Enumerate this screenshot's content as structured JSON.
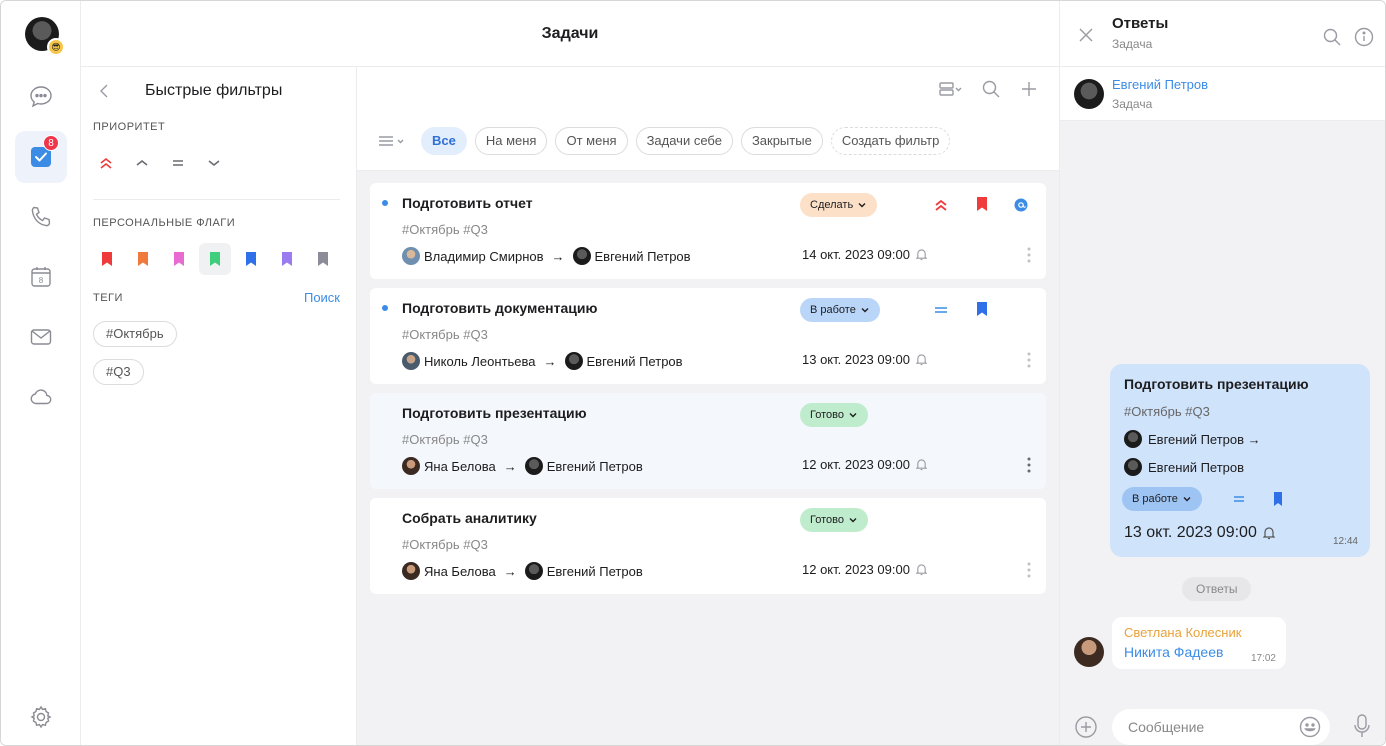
{
  "header": {
    "title": "Задачи"
  },
  "rail": {
    "tasks_badge": "8",
    "calendar_day": "8",
    "items": [
      "chat-icon",
      "tasks-icon",
      "phone-icon",
      "calendar-icon",
      "mail-icon",
      "cloud-icon",
      "settings-icon"
    ]
  },
  "filters": {
    "title": "Быстрые фильтры",
    "priority_label": "ПРИОРИТЕТ",
    "flags_label": "ПЕРСОНАЛЬНЫЕ ФЛАГИ",
    "flags": [
      {
        "color": "#ef3b3b"
      },
      {
        "color": "#f07a3c"
      },
      {
        "color": "#e86bd2"
      },
      {
        "color": "#3fce7c",
        "selected": true
      },
      {
        "color": "#2f6fe8"
      },
      {
        "color": "#9b7cf0"
      },
      {
        "color": "#8c8c99"
      }
    ],
    "tags_label": "ТЕГИ",
    "search_link": "Поиск",
    "tags": [
      "#Октябрь",
      "#Q3"
    ]
  },
  "toolbar": {
    "chips": [
      "Все",
      "На меня",
      "От меня",
      "Задачи себе",
      "Закрытые"
    ],
    "create_filter": "Создать фильтр"
  },
  "tasks": [
    {
      "title": "Подготовить отчет",
      "tags": "#Октябрь #Q3",
      "from": "Владимир Смирнов",
      "to": "Евгений Петров",
      "status": "Сделать",
      "status_color": "#fde0c8",
      "date": "14 окт. 2023 09:00",
      "unread": true,
      "priority": "high",
      "flag_color": "#ef3b3b",
      "mention": true
    },
    {
      "title": "Подготовить документацию",
      "tags": "#Октябрь #Q3",
      "from": "Николь Леонтьева",
      "to": "Евгений Петров",
      "status": "В работе",
      "status_color": "#b9d6f8",
      "date": "13 окт. 2023 09:00",
      "unread": true,
      "priority": "medium",
      "flag_color": "#2f6fe8",
      "mention": false
    },
    {
      "title": "Подготовить презентацию",
      "tags": "#Октябрь #Q3",
      "from": "Яна Белова",
      "to": "Евгений Петров",
      "status": "Готово",
      "status_color": "#bfeccc",
      "date": "12 окт. 2023 09:00",
      "unread": false,
      "priority": "none",
      "flag_color": "",
      "mention": false
    },
    {
      "title": "Собрать аналитику",
      "tags": "#Октябрь #Q3",
      "from": "Яна Белова",
      "to": "Евгений Петров",
      "status": "Готово",
      "status_color": "#bfeccc",
      "date": "12 окт. 2023 09:00",
      "unread": false,
      "priority": "none",
      "flag_color": "",
      "mention": false
    }
  ],
  "right": {
    "title": "Ответы",
    "subtitle": "Задача",
    "author": {
      "name": "Евгений Петров",
      "sub": "Задача"
    },
    "bubble": {
      "title": "Подготовить презентацию",
      "tags": "#Октябрь #Q3",
      "from": "Евгений Петров →",
      "to": "Евгений Петров",
      "status": "В работе",
      "date": "13 окт. 2023 09:00",
      "time": "12:44"
    },
    "separator": "Ответы",
    "reply": {
      "from": "Светлана Колесник",
      "text": "Никита Фадеев",
      "time": "17:02"
    },
    "composer_placeholder": "Сообщение"
  }
}
